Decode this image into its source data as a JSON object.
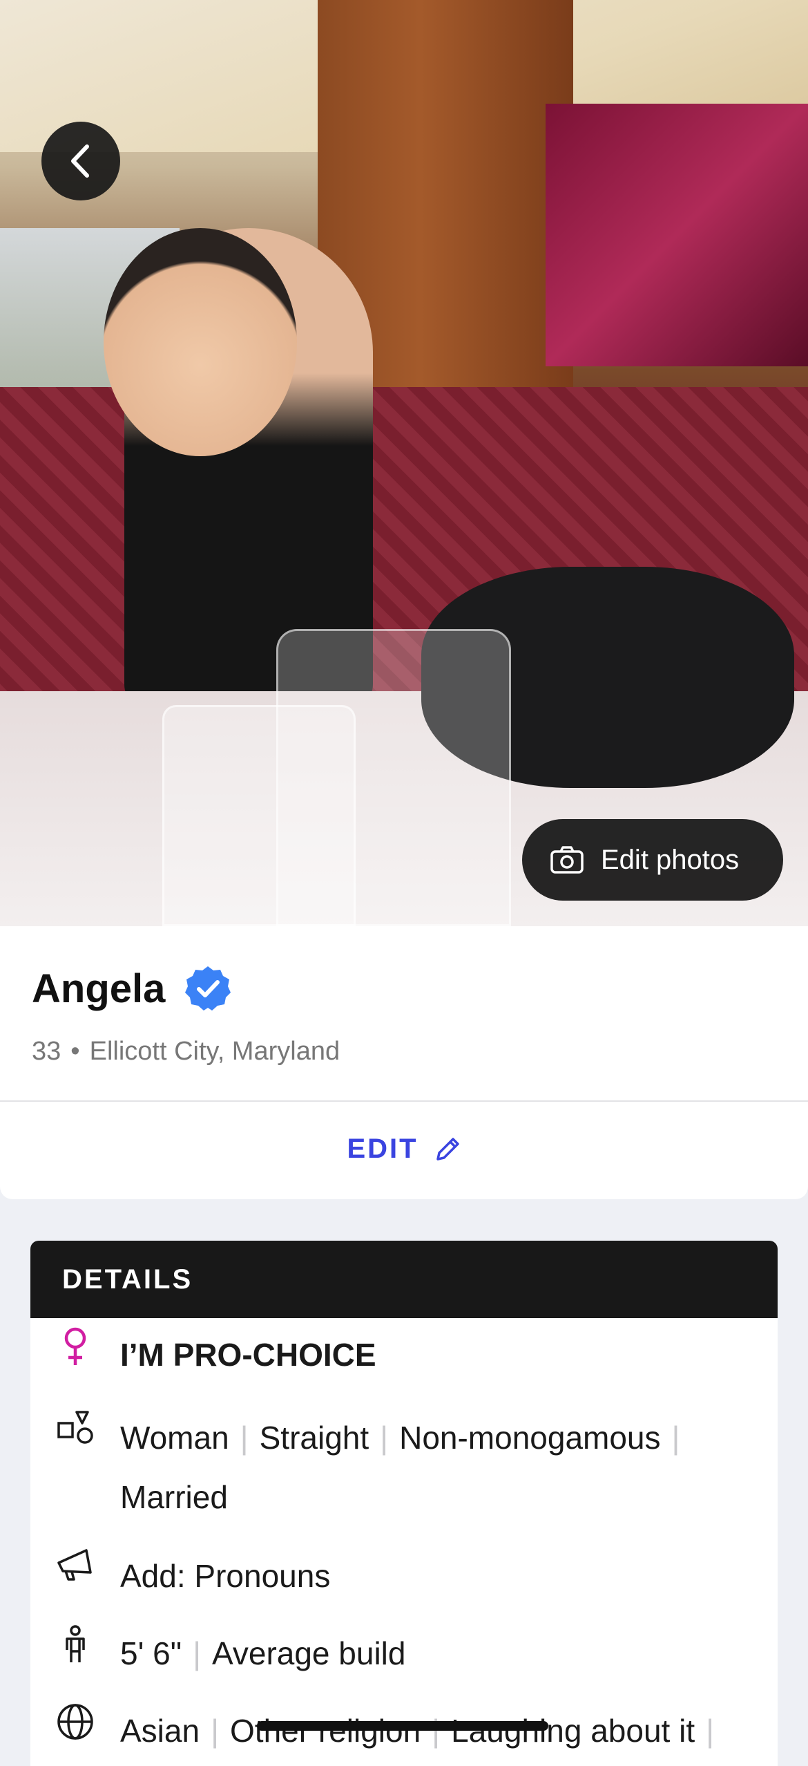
{
  "photo": {
    "description_icon": "profile-photo",
    "edit_label": "Edit photos"
  },
  "profile": {
    "name": "Angela",
    "age": "33",
    "location": "Ellicott City, Maryland",
    "verified_color": "#3b82f6"
  },
  "actions": {
    "edit_label": "EDIT"
  },
  "details": {
    "title": "DETAILS",
    "stance": "I’M PRO-CHOICE",
    "identity": [
      "Woman",
      "Straight",
      "Non-monogamous",
      "Married"
    ],
    "pronouns": "Add: Pronouns",
    "body": [
      "5' 6\"",
      "Average build"
    ],
    "background": [
      "Asian",
      "Other religion",
      "Laughing about it"
    ]
  },
  "colors": {
    "accent": "#3a44e0",
    "pro_choice": "#d11ea2",
    "header_bg": "#181818"
  }
}
